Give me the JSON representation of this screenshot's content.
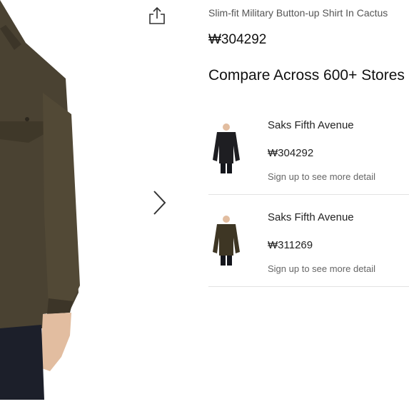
{
  "product": {
    "title": "Slim-fit Military Button-up Shirt In Cactus",
    "price": "₩304292"
  },
  "compare": {
    "heading": "Compare Across 600+ Stores"
  },
  "offers": [
    {
      "store": "Saks Fifth Avenue",
      "price": "₩304292",
      "note": "Sign up to see more detail",
      "shirt_color": "#1e1e22"
    },
    {
      "store": "Saks Fifth Avenue",
      "price": "₩311269",
      "note": "Sign up to see more detail",
      "shirt_color": "#3e3624"
    }
  ],
  "icons": {
    "share": "share-icon",
    "next": "chevron-right-icon"
  },
  "colors": {
    "shirt_olive": "#4a4232",
    "pants_navy": "#1c1f2a",
    "skin": "#e2bda0"
  }
}
